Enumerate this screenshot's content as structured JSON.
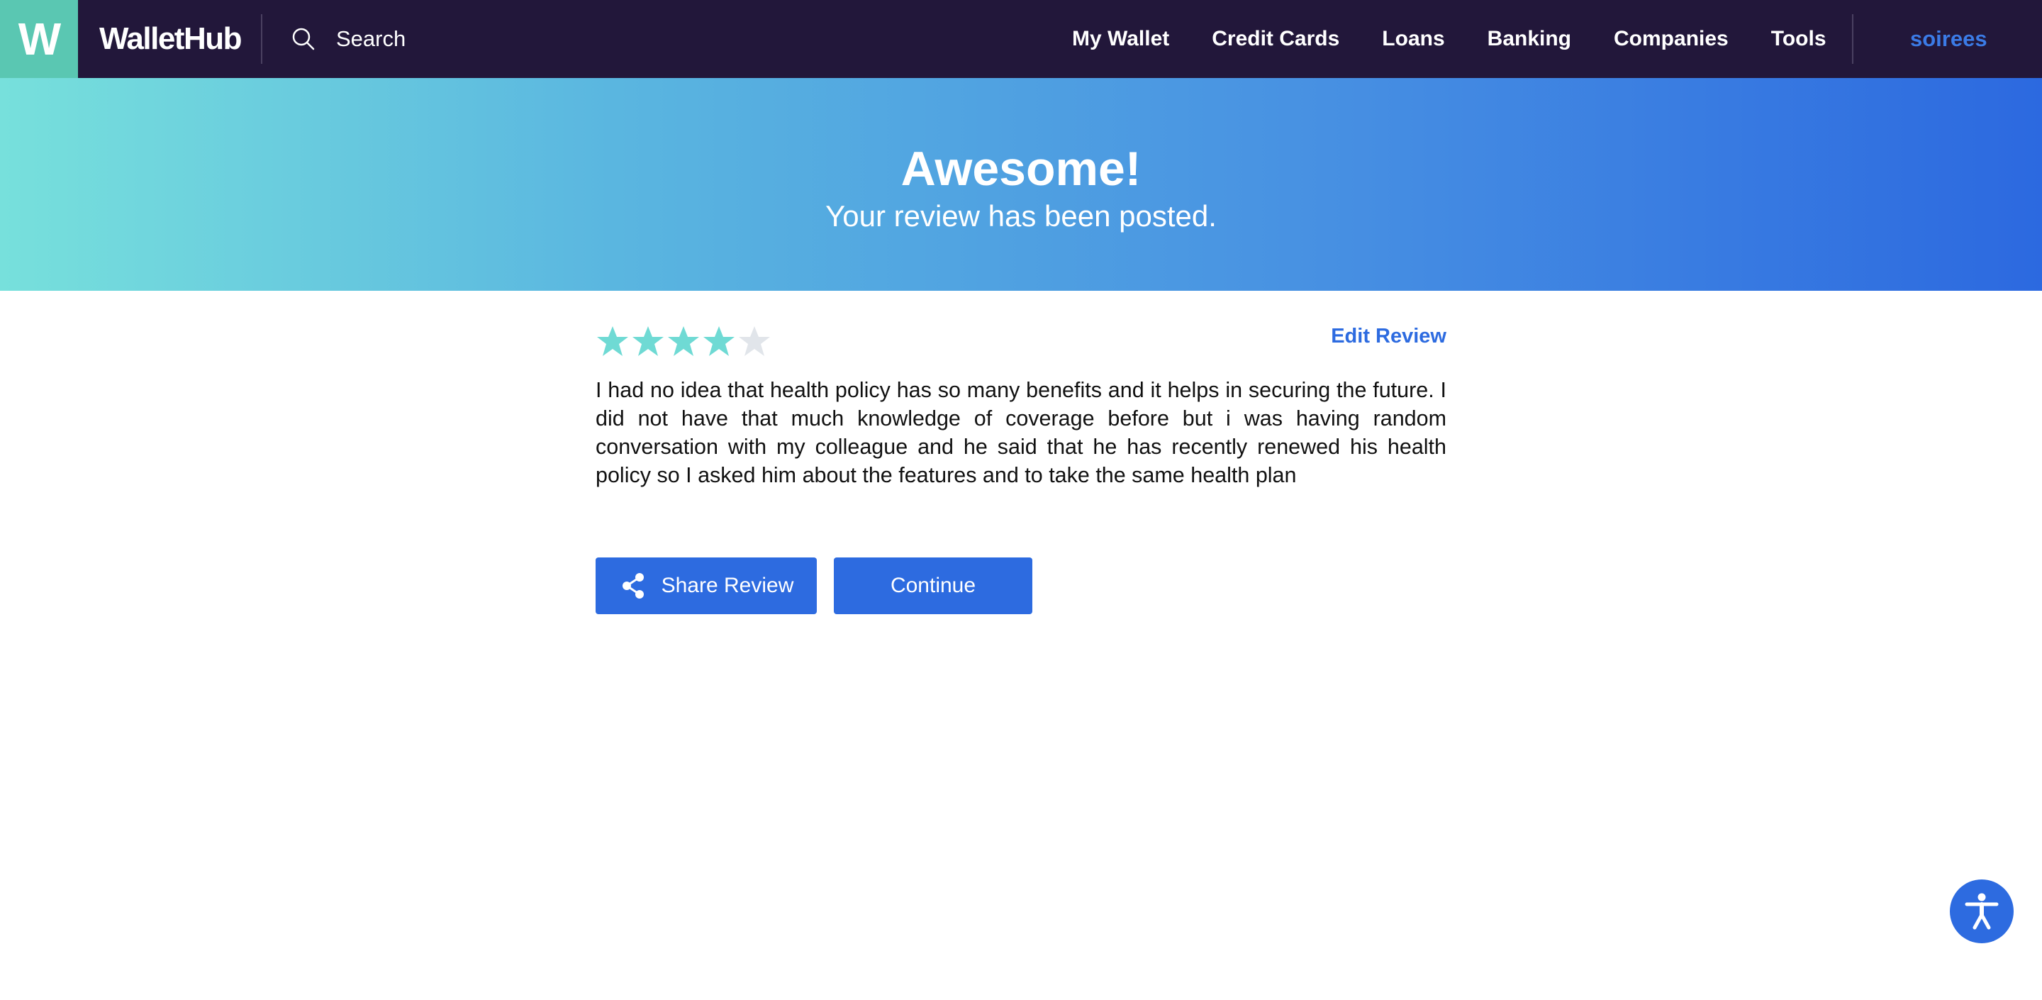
{
  "header": {
    "logo_letter": "W",
    "brand_name": "WalletHub",
    "search_placeholder": "Search",
    "nav": [
      "My Wallet",
      "Credit Cards",
      "Loans",
      "Banking",
      "Companies",
      "Tools"
    ],
    "username": "soirees"
  },
  "hero": {
    "title": "Awesome!",
    "subtitle": "Your review has been posted."
  },
  "review": {
    "rating": 4,
    "max_rating": 5,
    "edit_label": "Edit Review",
    "text": "I had no idea that health policy has so many benefits and it helps in securing the future. I did not have that much knowledge of coverage before but i was having random conversation with my colleague and he said that he has recently renewed his health policy so I asked him about the features and to take the same health plan"
  },
  "actions": {
    "share_label": "Share Review",
    "continue_label": "Continue"
  },
  "icons": {
    "search": "search-icon",
    "share": "share-icon",
    "star": "star-icon",
    "accessibility": "accessibility-icon"
  },
  "colors": {
    "topbar_bg": "#22173a",
    "logo_bg": "#5ac7b2",
    "accent_blue": "#2d6be0",
    "star_filled": "#6fdad4",
    "star_empty": "#e1e5ea",
    "hero_gradient_start": "#77e0dc",
    "hero_gradient_end": "#2c69e0"
  }
}
